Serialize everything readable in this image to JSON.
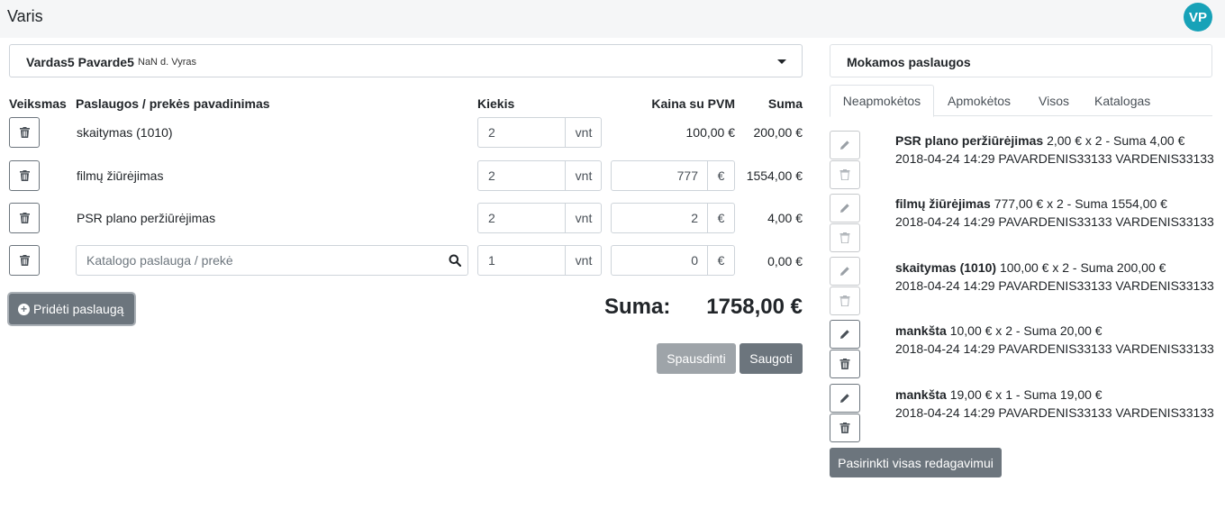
{
  "app": {
    "title": "Varis",
    "user_initials": "VP",
    "avatar_color": "#17a2b8"
  },
  "patient": {
    "name": "Vardas5 Pavarde5",
    "meta": "NaN d. Vyras"
  },
  "table": {
    "headers": {
      "action": "Veiksmas",
      "name": "Paslaugos / prekės pavadinimas",
      "qty": "Kiekis",
      "price": "Kaina su PVM",
      "sum": "Suma"
    },
    "rows": [
      {
        "name": "skaitymas (1010)",
        "qty": "2",
        "unit": "vnt",
        "price_static": "100,00 €",
        "sum": "200,00 €"
      },
      {
        "name": "filmų žiūrėjimas",
        "qty": "2",
        "unit": "vnt",
        "price_input": "777",
        "currency": "€",
        "sum": "1554,00 €"
      },
      {
        "name": "PSR plano peržiūrėjimas",
        "qty": "2",
        "unit": "vnt",
        "price_input": "2",
        "currency": "€",
        "sum": "4,00 €"
      }
    ],
    "new_row": {
      "search_placeholder": "Katalogo paslauga / prekė",
      "qty": "1",
      "unit": "vnt",
      "price_input": "0",
      "currency": "€",
      "sum": "0,00 €"
    }
  },
  "actions": {
    "add_service": "Pridėti paslaugą",
    "sum_label": "Suma:",
    "sum_value": "1758,00 €",
    "print": "Spausdinti",
    "save": "Saugoti"
  },
  "panel": {
    "title": "Mokamos paslaugos",
    "tabs": [
      "Neapmokėtos",
      "Apmokėtos",
      "Visos",
      "Katalogas"
    ],
    "active_tab": "Neapmokėtos",
    "items": [
      {
        "name": "PSR plano peržiūrėjimas",
        "detail": "2,00 € x 2 - Suma 4,00 €",
        "meta": "2018-04-24 14:29 PAVARDENIS33133 VARDENIS33133",
        "enabled": false
      },
      {
        "name": "filmų žiūrėjimas",
        "detail": "777,00 € x 2 - Suma 1554,00 €",
        "meta": "2018-04-24 14:29 PAVARDENIS33133 VARDENIS33133",
        "enabled": false
      },
      {
        "name": "skaitymas (1010)",
        "detail": "100,00 € x 2 - Suma 200,00 €",
        "meta": "2018-04-24 14:29 PAVARDENIS33133 VARDENIS33133",
        "enabled": false
      },
      {
        "name": "mankšta",
        "detail": "10,00 € x 2 - Suma 20,00 €",
        "meta": "2018-04-24 14:29 PAVARDENIS33133 VARDENIS33133",
        "enabled": true
      },
      {
        "name": "mankšta",
        "detail": "19,00 € x 1 - Suma 19,00 €",
        "meta": "2018-04-24 14:29 PAVARDENIS33133 VARDENIS33133",
        "enabled": true
      }
    ],
    "select_all": "Pasirinkti visas redagavimui"
  }
}
